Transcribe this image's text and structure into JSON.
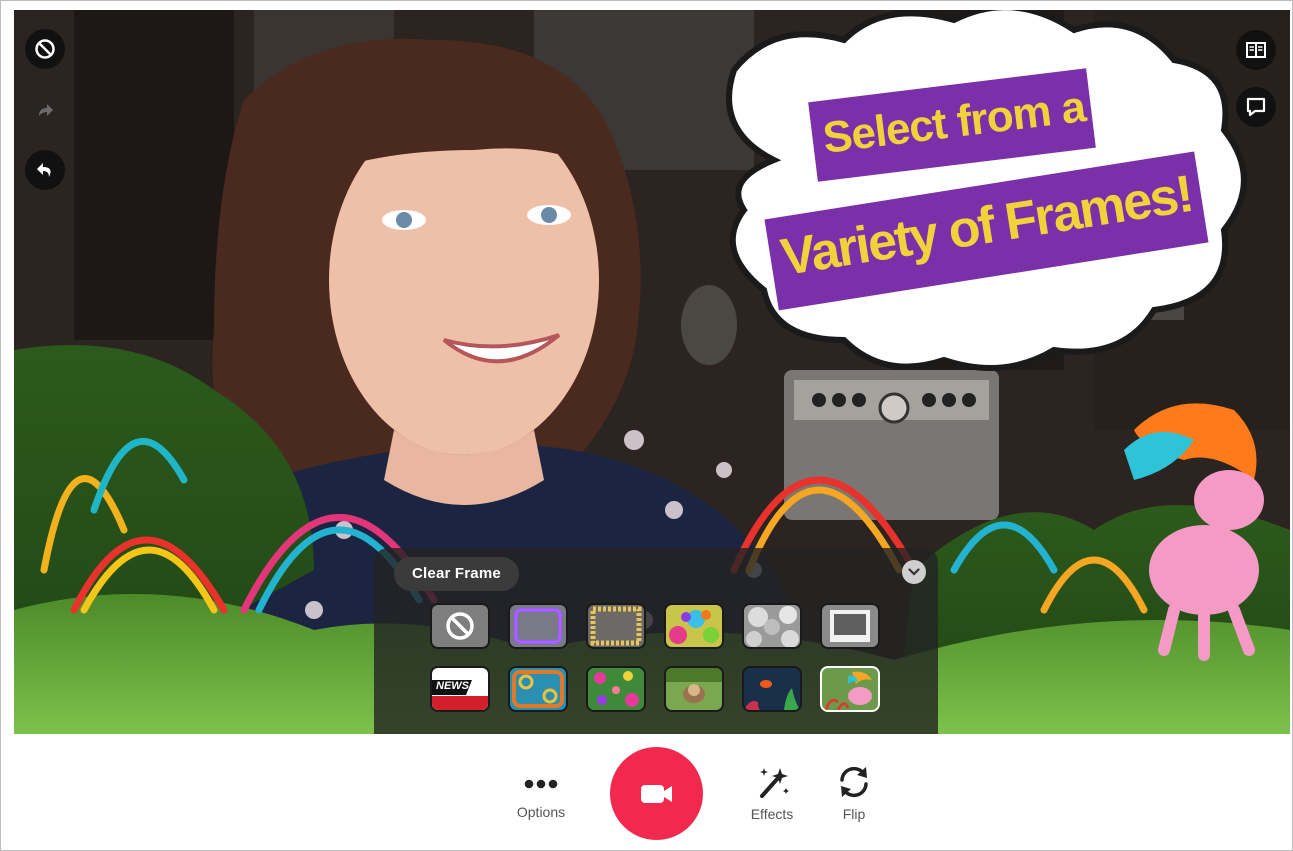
{
  "camera": {
    "bubble_line1": "Select from a",
    "bubble_line2": "Variety of Frames!"
  },
  "top_left_controls": [
    {
      "icon": "block-icon"
    },
    {
      "icon": "redo-icon"
    },
    {
      "icon": "undo-icon"
    }
  ],
  "top_right_controls": [
    {
      "icon": "book-icon"
    },
    {
      "icon": "screen-icon"
    }
  ],
  "frames_panel": {
    "clear_label": "Clear Frame",
    "collapse_icon": "chevron-down-icon",
    "tiles": [
      {
        "name": "none",
        "selected": false
      },
      {
        "name": "neon-border",
        "selected": false
      },
      {
        "name": "gold-border",
        "selected": false
      },
      {
        "name": "paint-splatter",
        "selected": false
      },
      {
        "name": "bubbles",
        "selected": false
      },
      {
        "name": "polaroid",
        "selected": false
      },
      {
        "name": "news",
        "label": "NEWS",
        "selected": false
      },
      {
        "name": "tile-pattern",
        "selected": false
      },
      {
        "name": "flowers",
        "selected": false
      },
      {
        "name": "sloth",
        "selected": false
      },
      {
        "name": "ocean",
        "selected": false
      },
      {
        "name": "unicorn",
        "selected": true
      }
    ]
  },
  "bottom_bar": {
    "options_label": "Options",
    "effects_label": "Effects",
    "flip_label": "Flip",
    "record_color": "#f2294e"
  }
}
